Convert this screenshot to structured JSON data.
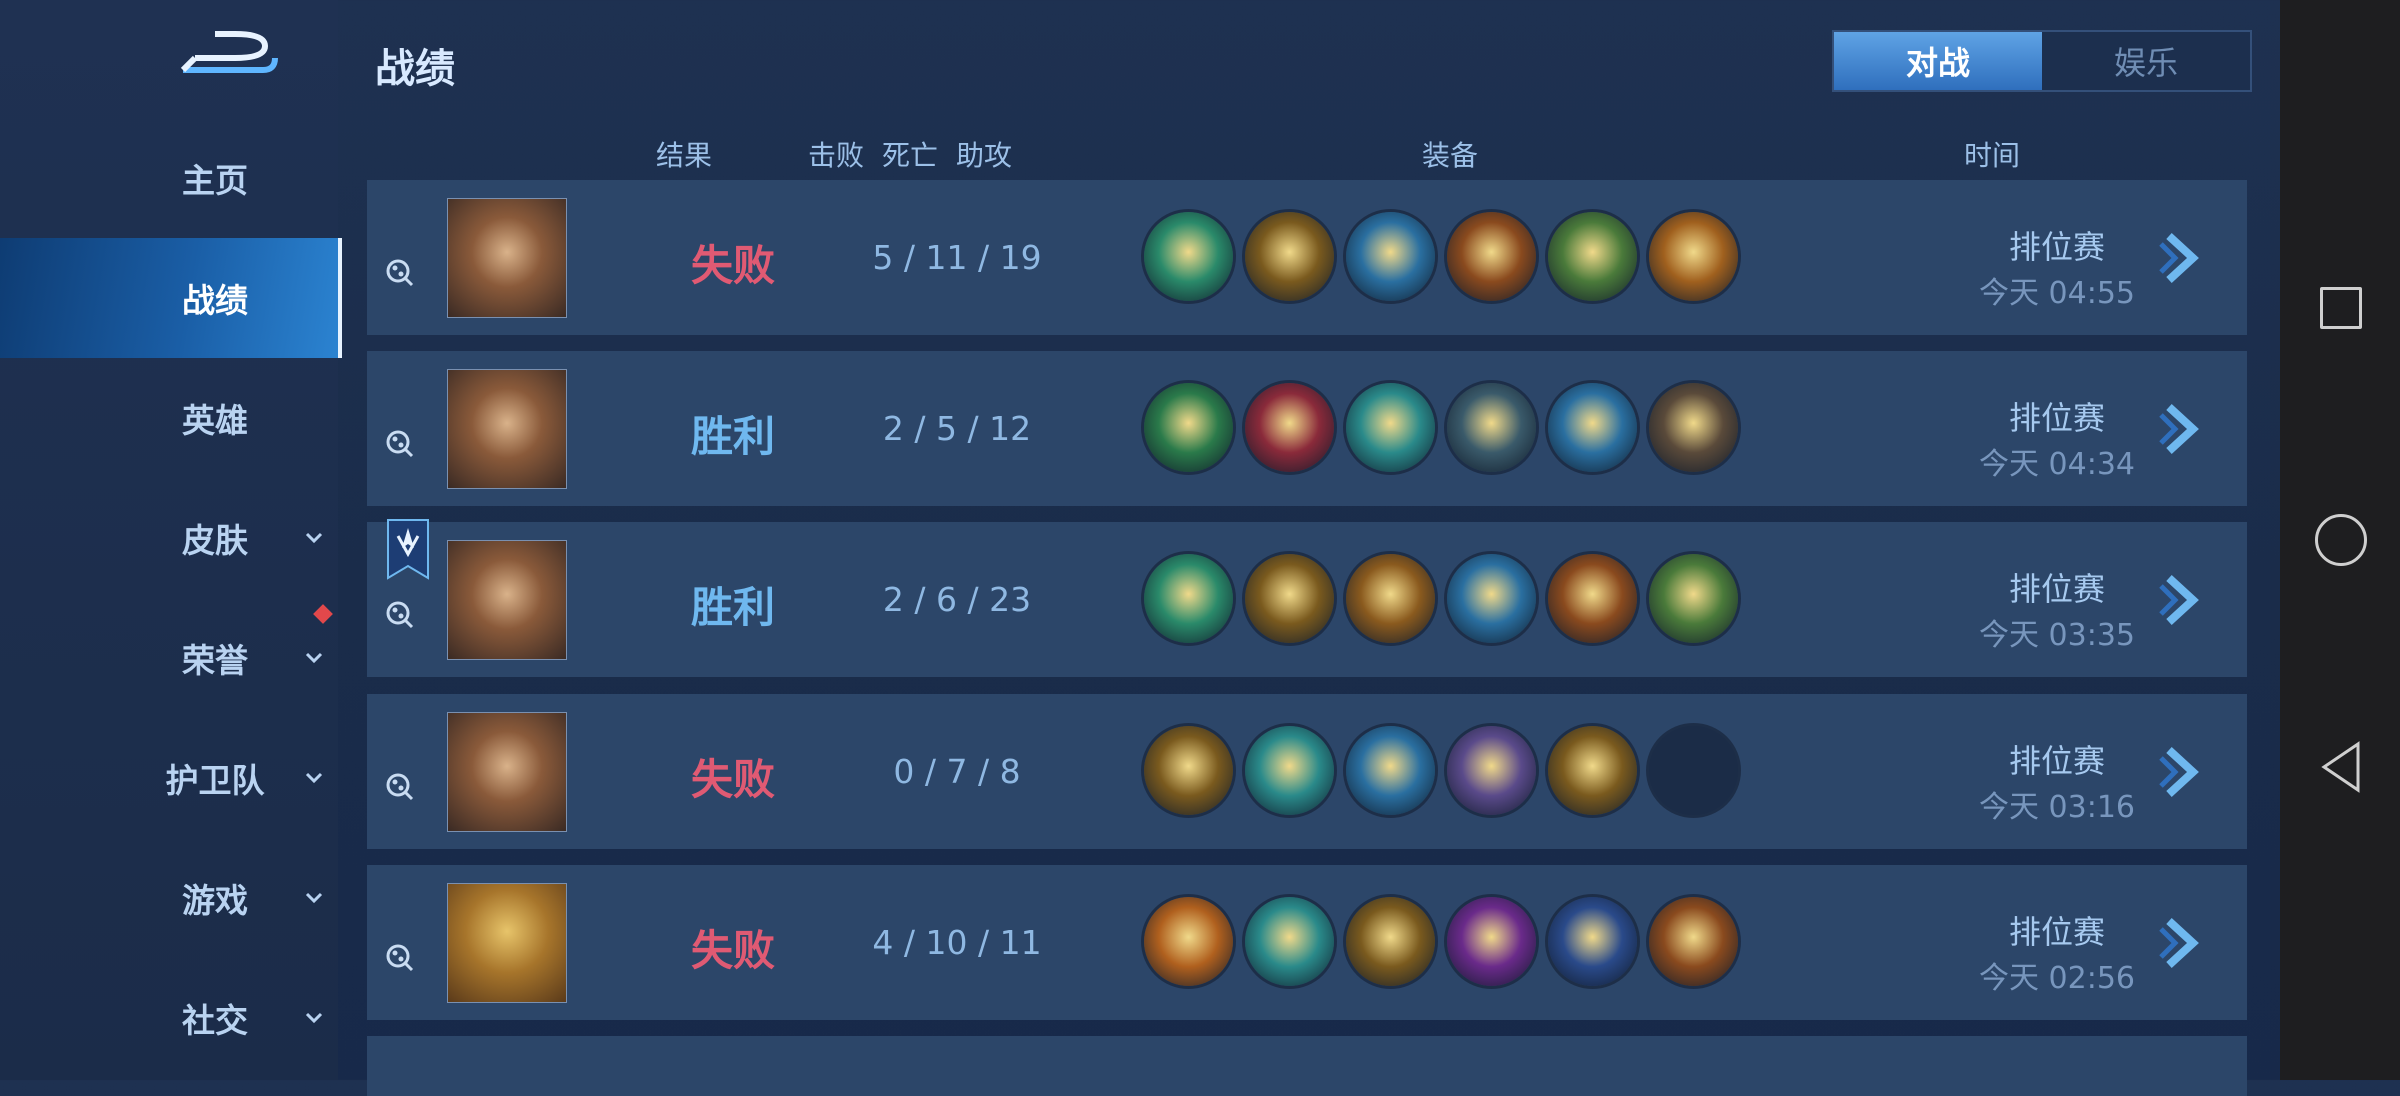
{
  "sidebar": {
    "items": [
      {
        "label": "主页",
        "active": false,
        "has_chevron": false
      },
      {
        "label": "战绩",
        "active": true,
        "has_chevron": false
      },
      {
        "label": "英雄",
        "active": false,
        "has_chevron": false
      },
      {
        "label": "皮肤",
        "active": false,
        "has_chevron": true
      },
      {
        "label": "荣誉",
        "active": false,
        "has_chevron": true
      },
      {
        "label": "护卫队",
        "active": false,
        "has_chevron": true
      },
      {
        "label": "游戏",
        "active": false,
        "has_chevron": true
      },
      {
        "label": "社交",
        "active": false,
        "has_chevron": true
      }
    ]
  },
  "header": {
    "title": "战绩",
    "tabs": [
      {
        "label": "对战",
        "active": true
      },
      {
        "label": "娱乐",
        "active": false
      }
    ]
  },
  "columns": {
    "result": "结果",
    "kills": "击败",
    "deaths": "死亡",
    "assists": "助攻",
    "equipment": "装备",
    "time": "时间"
  },
  "matches": [
    {
      "result": "失败",
      "outcome": "lose",
      "kda": "5  /  11  /  19",
      "mode": "排位赛",
      "time": "今天 04:55",
      "items": [
        "#2a8a6a",
        "#7a5a1e",
        "#2a6fa0",
        "#8a4a1e",
        "#4a7a3a",
        "#a0601e"
      ],
      "has_badge": false
    },
    {
      "result": "胜利",
      "outcome": "win",
      "kda": "2  /  5  /  12",
      "mode": "排位赛",
      "time": "今天 04:34",
      "items": [
        "#2a7a4a",
        "#8a2a3a",
        "#2a8a8a",
        "#3a5a6a",
        "#2a6fa0",
        "#5a4a3a"
      ],
      "has_badge": false
    },
    {
      "result": "胜利",
      "outcome": "win",
      "kda": "2  /  6  /  23",
      "mode": "排位赛",
      "time": "今天 03:35",
      "items": [
        "#2a8a6a",
        "#7a5a1e",
        "#8a5a1e",
        "#2a6fa0",
        "#8a4a1e",
        "#4a7a3a"
      ],
      "has_badge": true
    },
    {
      "result": "失败",
      "outcome": "lose",
      "kda": "0  /  7  /  8",
      "mode": "排位赛",
      "time": "今天 03:16",
      "items": [
        "#7a5a1e",
        "#2a8a8a",
        "#2a6fa0",
        "#5a4a8a",
        "#7a5a1e",
        "empty"
      ],
      "has_badge": false
    },
    {
      "result": "失败",
      "outcome": "lose",
      "kda": "4  /  10  /  11",
      "mode": "排位赛",
      "time": "今天 02:56",
      "items": [
        "#b0601e",
        "#2a8a8a",
        "#7a5a1e",
        "#6a2a8a",
        "#2a4a8a",
        "#8a4a1e"
      ],
      "has_badge": false
    }
  ],
  "colors": {
    "lose": "#e05a73",
    "win": "#6fb8ef",
    "active_nav": "#1a5ea6"
  }
}
